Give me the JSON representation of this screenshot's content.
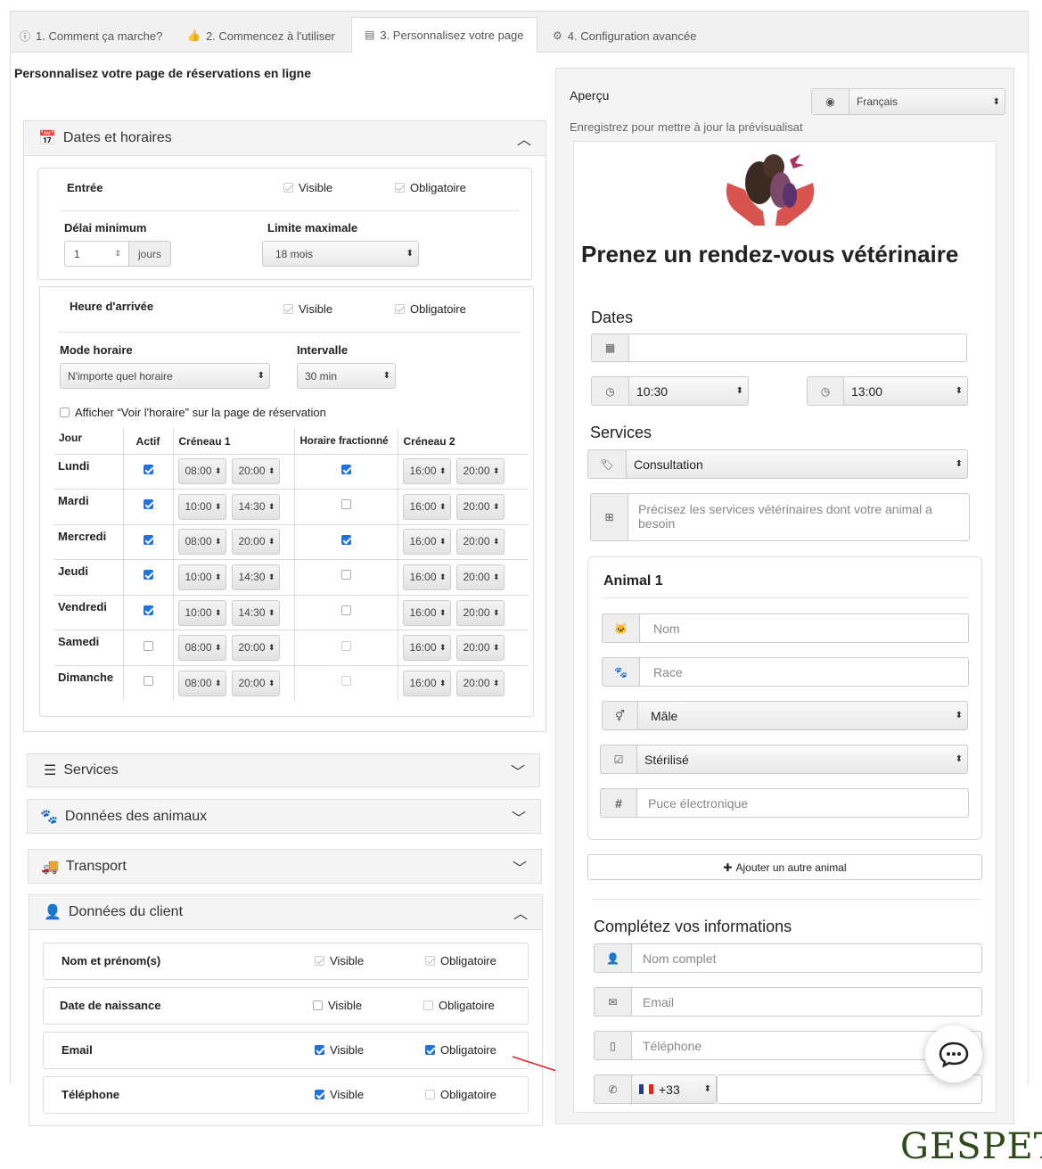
{
  "tabs": [
    {
      "label": "1. Comment ça marche?",
      "icon": "info-icon"
    },
    {
      "label": "2. Commencez à l'utiliser",
      "icon": "thumbs-up-icon"
    },
    {
      "label": "3. Personnalisez votre page",
      "icon": "calendar-icon"
    },
    {
      "label": "4. Configuration avancée",
      "icon": "gears-icon"
    }
  ],
  "left": {
    "page_title": "Personnalisez votre page de réservations en ligne",
    "dates_panel": {
      "title": "Dates et horaires",
      "entree": {
        "label": "Entrée",
        "visible": "Visible",
        "obligatoire": "Obligatoire"
      },
      "delai_label": "Délai minimum",
      "delai_value": "1",
      "delai_unit": "jours",
      "limite_label": "Limite maximale",
      "limite_value": "18 mois",
      "heure": {
        "label": "Heure d'arrivée",
        "visible": "Visible",
        "obligatoire": "Obligatoire"
      },
      "mode_label": "Mode horaire",
      "mode_value": "N'importe quel horaire",
      "intervalle_label": "Intervalle",
      "intervalle_value": "30 min",
      "afficher_label": "Afficher “Voir l'horaire” sur la page de réservation",
      "table_headers": [
        "Jour",
        "Actif",
        "Créneau 1",
        "Horaire fractionné",
        "Créneau 2"
      ],
      "rows": [
        {
          "day": "Lundi",
          "active": true,
          "s1": "08:00",
          "e1": "20:00",
          "split": true,
          "s2": "16:00",
          "e2": "20:00"
        },
        {
          "day": "Mardi",
          "active": true,
          "s1": "10:00",
          "e1": "14:30",
          "split": false,
          "s2": "16:00",
          "e2": "20:00"
        },
        {
          "day": "Mercredi",
          "active": true,
          "s1": "08:00",
          "e1": "20:00",
          "split": true,
          "s2": "16:00",
          "e2": "20:00"
        },
        {
          "day": "Jeudi",
          "active": true,
          "s1": "10:00",
          "e1": "14:30",
          "split": false,
          "s2": "16:00",
          "e2": "20:00"
        },
        {
          "day": "Vendredi",
          "active": true,
          "s1": "10:00",
          "e1": "14:30",
          "split": false,
          "s2": "16:00",
          "e2": "20:00"
        },
        {
          "day": "Samedi",
          "active": false,
          "s1": "08:00",
          "e1": "20:00",
          "split": false,
          "s2": "16:00",
          "e2": "20:00"
        },
        {
          "day": "Dimanche",
          "active": false,
          "s1": "08:00",
          "e1": "20:00",
          "split": false,
          "s2": "16:00",
          "e2": "20:00"
        }
      ]
    },
    "services_panel": {
      "title": "Services"
    },
    "animaux_panel": {
      "title": "Données des animaux"
    },
    "transport_panel": {
      "title": "Transport"
    },
    "client_panel": {
      "title": "Données du client",
      "fields": [
        {
          "label": "Nom et prénom(s)",
          "visible": "Visible",
          "obligatoire": "Obligatoire"
        },
        {
          "label": "Date de naissance",
          "visible": "Visible",
          "obligatoire": "Obligatoire"
        },
        {
          "label": "Email",
          "visible": "Visible",
          "obligatoire": "Obligatoire"
        },
        {
          "label": "Téléphone",
          "visible": "Visible",
          "obligatoire": "Obligatoire"
        }
      ]
    }
  },
  "right": {
    "apercu": "Aperçu",
    "language": "Français",
    "save_note": "Enregistrez pour mettre à jour la prévisualisat",
    "heading": "Prenez un rendez-vous vétérinaire",
    "dates_title": "Dates",
    "time_start": "10:30",
    "time_end": "13:00",
    "services_title": "Services",
    "service_value": "Consultation",
    "service_placeholder": "Précisez les services vétérinaires dont votre animal a besoin",
    "animal_title": "Animal 1",
    "nom_placeholder": "Nom",
    "race_placeholder": "Race",
    "sexe_value": "Mâle",
    "sterilise_value": "Stérilisé",
    "puce_placeholder": "Puce électronique",
    "add_animal": "Ajouter un autre animal",
    "info_title": "Complétez vos informations",
    "nom_complet_placeholder": "Nom complet",
    "email_placeholder": "Email",
    "telephone_placeholder": "Téléphone",
    "phone_code": "+33"
  },
  "brand": "GESPET",
  "colors": {
    "accent": "#1a73e8",
    "arrow": "#d9252b",
    "brand": "#2f4a1f",
    "logo": "#d9534f"
  }
}
